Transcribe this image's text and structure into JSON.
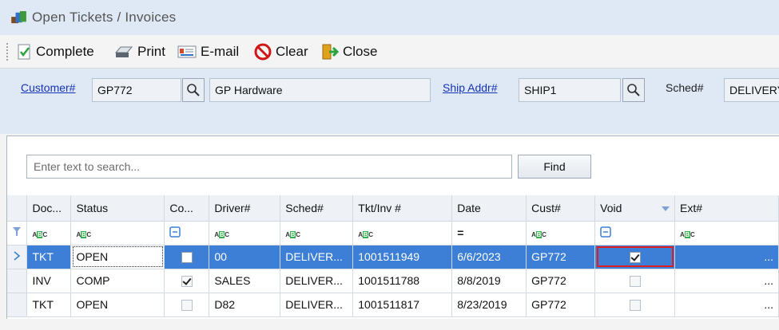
{
  "window": {
    "title": "Open Tickets / Invoices",
    "icon": "tickets-app-icon"
  },
  "toolbar": {
    "complete_label": "Complete",
    "print_label": "Print",
    "email_label": "E-mail",
    "clear_label": "Clear",
    "close_label": "Close"
  },
  "header": {
    "customer_label": "Customer#",
    "customer_number": "GP772",
    "customer_name": "GP Hardware",
    "ship_addr_label": "Ship Addr#",
    "ship_addr": "SHIP1",
    "sched_label": "Sched#",
    "sched_value": "DELIVERY"
  },
  "search": {
    "placeholder": "Enter text to search...",
    "find_label": "Find"
  },
  "grid": {
    "columns": [
      "Doc...",
      "Status",
      "Co...",
      "Driver#",
      "Sched#",
      "Tkt/Inv #",
      "Date",
      "Cust#",
      "Void",
      "Ext#"
    ],
    "filter_row": [
      "abc",
      "abc",
      "checkbox",
      "abc",
      "abc",
      "abc",
      "=",
      "abc",
      "checkbox",
      "abc"
    ],
    "rows": [
      {
        "doc": "TKT",
        "status": "OPEN",
        "complete": false,
        "driver": "00",
        "sched": "DELIVER...",
        "tkt": "1001511949",
        "date": "6/6/2023",
        "cust": "GP772",
        "void": true,
        "ext": "...",
        "selected": true
      },
      {
        "doc": "INV",
        "status": "COMP",
        "complete": true,
        "driver": "SALES",
        "sched": "DELIVER...",
        "tkt": "1001511788",
        "date": "8/8/2019",
        "cust": "GP772",
        "void": false,
        "ext": "...",
        "selected": false
      },
      {
        "doc": "TKT",
        "status": "OPEN",
        "complete": false,
        "driver": "D82",
        "sched": "DELIVER...",
        "tkt": "1001511817",
        "date": "8/23/2019",
        "cust": "GP772",
        "void": false,
        "ext": "...",
        "selected": false
      }
    ]
  },
  "colors": {
    "header_bg": "#dfe9f6",
    "selection": "#3d7fd6",
    "highlight": "#e02020",
    "link": "#1533b8"
  }
}
